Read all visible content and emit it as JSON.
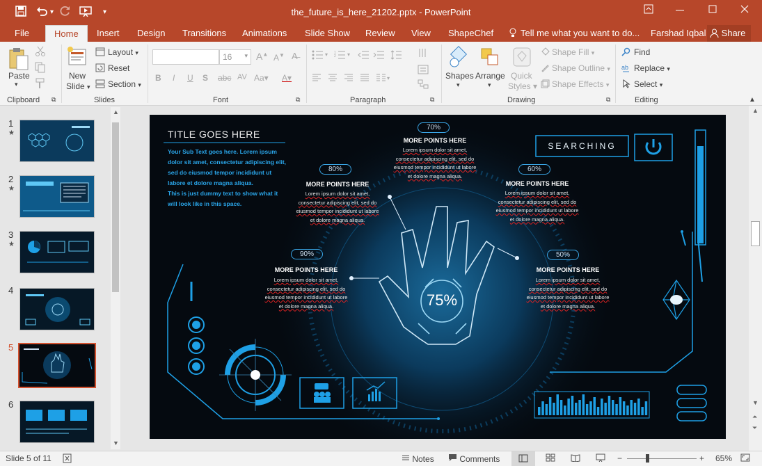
{
  "window": {
    "title": "the_future_is_here_21202.pptx - PowerPoint",
    "user": "Farshad Iqbal",
    "share": "Share",
    "tell_me": "Tell me what you want to do..."
  },
  "tabs": [
    "File",
    "Home",
    "Insert",
    "Design",
    "Transitions",
    "Animations",
    "Slide Show",
    "Review",
    "View",
    "ShapeChef"
  ],
  "ribbon": {
    "clipboard": {
      "paste": "Paste",
      "label": "Clipboard"
    },
    "slides": {
      "new_slide": "New Slide",
      "new_slide_arrow": "▾",
      "layout": "Layout",
      "reset": "Reset",
      "section": "Section",
      "label": "Slides"
    },
    "font": {
      "font_name": "",
      "font_size": "16",
      "label": "Font"
    },
    "paragraph": {
      "label": "Paragraph"
    },
    "drawing": {
      "shapes": "Shapes",
      "arrange": "Arrange",
      "quick_styles": "Quick Styles",
      "shape_fill": "Shape Fill",
      "shape_outline": "Shape Outline",
      "shape_effects": "Shape Effects",
      "label": "Drawing"
    },
    "editing": {
      "find": "Find",
      "replace": "Replace",
      "select": "Select",
      "label": "Editing"
    }
  },
  "thumbnails": [
    {
      "num": "1",
      "star": "★"
    },
    {
      "num": "2",
      "star": "★"
    },
    {
      "num": "3",
      "star": "★"
    },
    {
      "num": "4",
      "star": ""
    },
    {
      "num": "5",
      "star": ""
    },
    {
      "num": "6",
      "star": ""
    }
  ],
  "slide": {
    "title": "TITLE GOES HERE",
    "subtext_lines": [
      "Your Sub Text goes here. Lorem ipsum",
      "dolor sit amet, consectetur adipiscing elit,",
      "sed do eiusmod tempor incididunt ut",
      "labore et dolore magna aliqua.",
      "This is just dummy text to show what it",
      "will look like in this space."
    ],
    "searching": "SEARCHING",
    "center_pct": "75%",
    "points": [
      {
        "pct": "70%",
        "title": "MORE POINTS HERE"
      },
      {
        "pct": "80%",
        "title": "MORE POINTS HERE"
      },
      {
        "pct": "60%",
        "title": "MORE POINTS HERE"
      },
      {
        "pct": "90%",
        "title": "MORE POINTS HERE"
      },
      {
        "pct": "50%",
        "title": "MORE POINTS HERE"
      }
    ],
    "point_body_lines": [
      "Lorem ipsum dolor sit amet,",
      "consectetur adipiscing elit, sed do",
      "eiusmod tempor incididunt ut labore",
      "et dolore magna aliqua."
    ]
  },
  "status": {
    "slide_of": "Slide 5 of 11",
    "notes": "Notes",
    "comments": "Comments",
    "zoom": "65%"
  },
  "colors": {
    "accent": "#b7472a",
    "selected_thumb": "#d35230",
    "slide_cyan": "#1ea0e6"
  }
}
